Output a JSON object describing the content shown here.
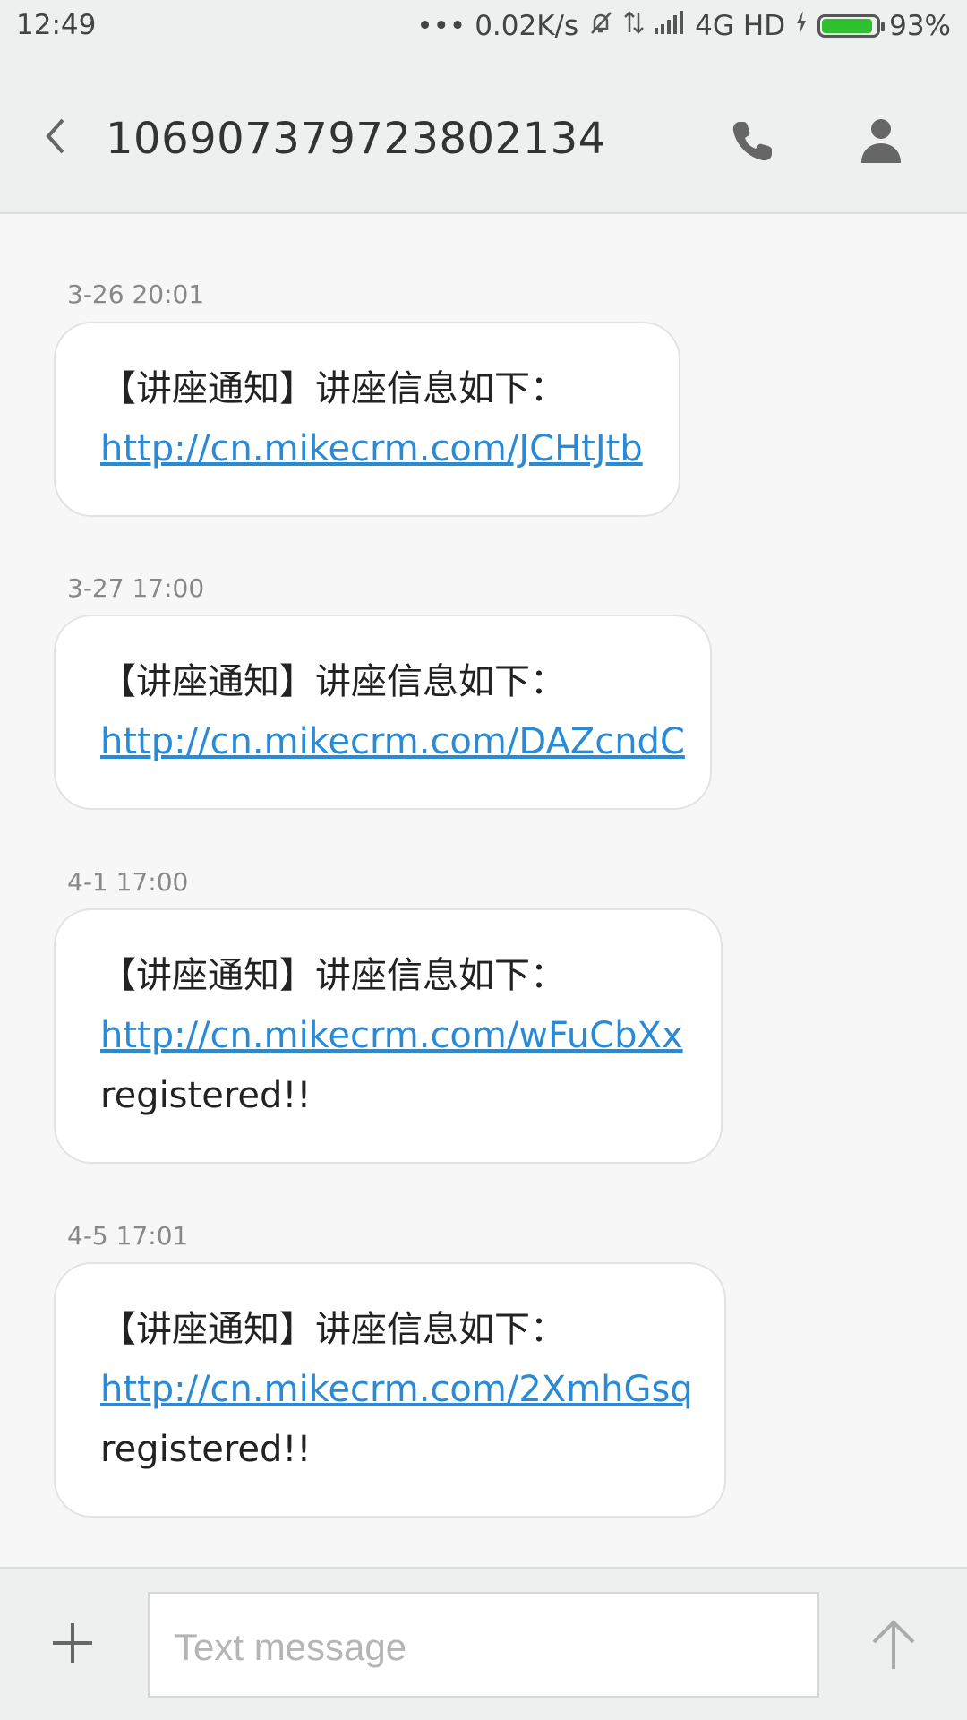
{
  "status_bar": {
    "time": "12:49",
    "dots": "•••",
    "net_speed": "0.02K/s",
    "network": "4G",
    "hd": "HD",
    "battery_percent": "93%",
    "battery_level": 0.93,
    "battery_color": "#2ec02e"
  },
  "header": {
    "title": "10690737972380213 4",
    "back_icon": "chevron-left-icon",
    "call_icon": "phone-icon",
    "contact_icon": "person-icon"
  },
  "messages": [
    {
      "time": "3-26 20:01",
      "text": "【讲座通知】讲座信息如下：",
      "link": "http://cn.mikecrm.com/JCHtJtb",
      "extra": ""
    },
    {
      "time": "3-27 17:00",
      "text": "【讲座通知】讲座信息如下：",
      "link": "http://cn.mikecrm.com/DAZcndC",
      "extra": ""
    },
    {
      "time": "4-1 17:00",
      "text": "【讲座通知】讲座信息如下：",
      "link": "http://cn.mikecrm.com/wFuCbXx",
      "extra": "registered!!"
    },
    {
      "time": "4-5 17:01",
      "text": "【讲座通知】讲座信息如下：",
      "link": "http://cn.mikecrm.com/2XmhGsq",
      "extra": "registered!!"
    }
  ],
  "composer": {
    "placeholder": "Text message",
    "add_icon": "plus-icon",
    "send_icon": "arrow-up-icon"
  },
  "colors": {
    "link": "#2a8ad6",
    "background": "#f7f7f7",
    "bar": "#eef0f0"
  }
}
